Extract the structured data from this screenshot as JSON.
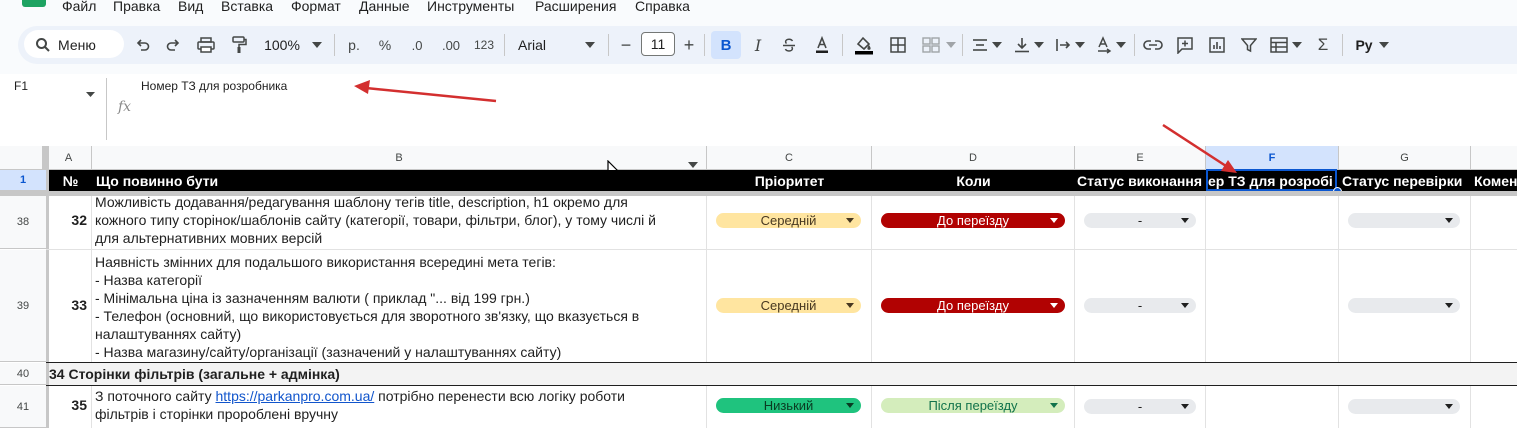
{
  "menu": {
    "items": [
      "Файл",
      "Правка",
      "Вид",
      "Вставка",
      "Формат",
      "Данные",
      "Инструменты",
      "Расширения",
      "Справка"
    ]
  },
  "toolbar": {
    "search_label": "Меню",
    "zoom": "100%",
    "currency": "р.",
    "percent": "%",
    "dec_decrease": ".0",
    "dec_increase": ".00",
    "format_123": "123",
    "font": "Arial",
    "font_size": "11",
    "minus": "−",
    "plus": "+",
    "sigma": "Σ",
    "input_tools": "Рy"
  },
  "formula_bar": {
    "cell_ref": "F1",
    "fx": "fx",
    "content": "Номер ТЗ для розробника"
  },
  "columns": [
    "A",
    "B",
    "C",
    "D",
    "E",
    "F",
    "G"
  ],
  "row_numbers": {
    "r1": "1",
    "r38": "38",
    "r39": "39",
    "r40": "40",
    "r41": "41"
  },
  "header": {
    "no": "№",
    "what": "Що повинно бути",
    "priority": "Пріоритет",
    "when": "Коли",
    "status": "Статус виконання",
    "tz": "ер ТЗ для розробі",
    "check": "Статус перевірки",
    "comment": "Комен"
  },
  "rows": {
    "r38": {
      "num": "32",
      "text": "Можливість додавання/редагування шаблону тегів title, description, h1 окремо для\nкожного типу сторінок/шаблонів сайту (категорії, товари, фільтри, блог), у тому числі й\nдля альтернативних мовних версій",
      "priority": "Середній",
      "when": "До переїзду",
      "status": "-"
    },
    "r39": {
      "num": "33",
      "text": "Наявність змінних для подальшого використання всередині мета тегів:\n- Назва категорії\n- Мінімальна ціна із зазначенням валюти ( приклад \"... від 199 грн.)\n- Телефон (основний, що використовується для зворотного зв'язку, що вказується в\nналаштуваннях сайту)\n- Назва магазину/сайту/організації (зазначений у налаштуваннях сайту)",
      "priority": "Середній",
      "when": "До переїзду",
      "status": "-"
    },
    "r40": {
      "section": "34 Сторінки фільтрів (загальне + адмінка)"
    },
    "r41": {
      "num": "35",
      "text_before": "З поточного сайту ",
      "link": "https://parkanpro.com.ua/",
      "text_after": " потрібно перенести всю логіку роботи\nфільтрів і сторінки пророблені вручну",
      "priority": "Низький",
      "when": "Після переїзду",
      "status": "-"
    }
  },
  "colors": {
    "selection": "#0b57d0",
    "annotation_arrow": "#d32f2f",
    "chip_red": "#b10202",
    "chip_medium": "#ffe5a0",
    "chip_low": "#1fc37e",
    "chip_after": "#d4edbc"
  }
}
